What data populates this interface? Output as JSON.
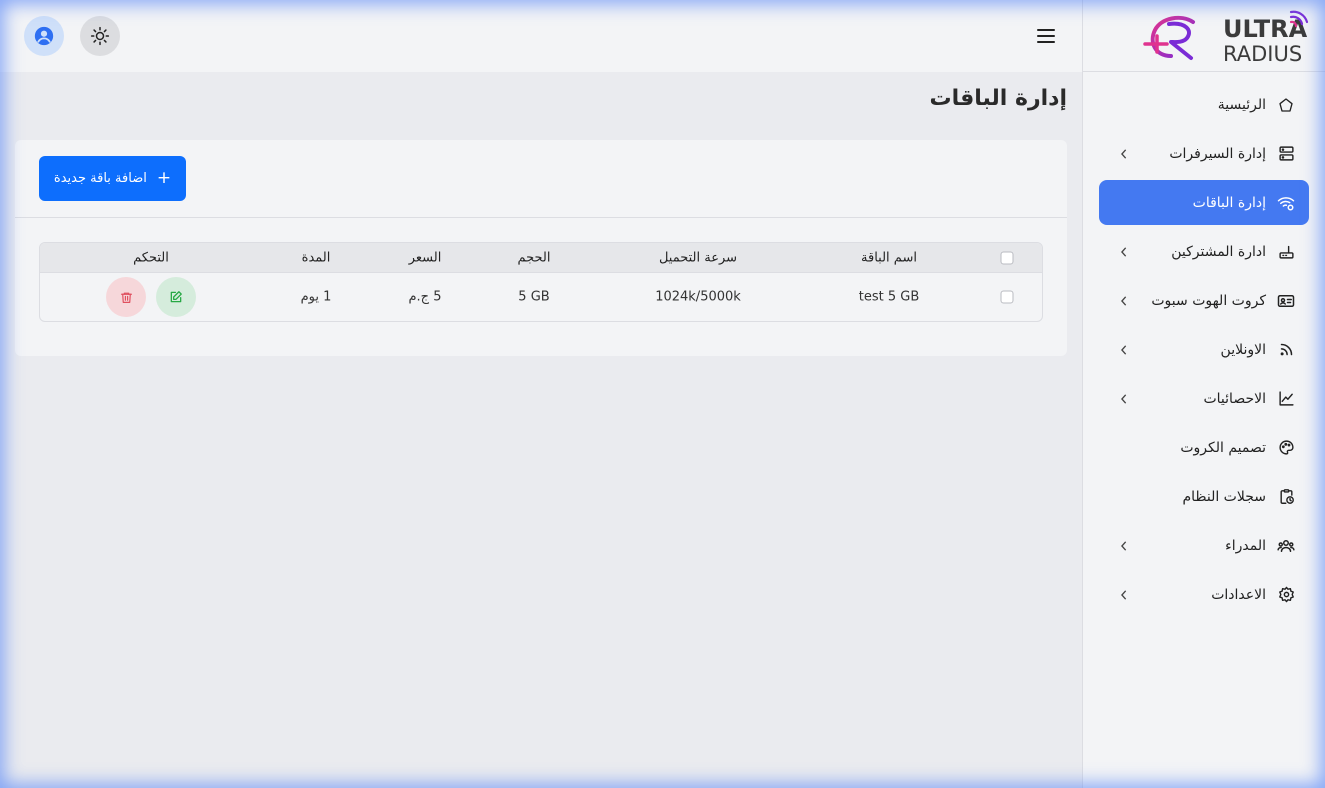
{
  "brand": {
    "line1": "ULTRA",
    "line2": "RADIUS",
    "accent": "#8a2be2",
    "accent2": "#e0338f"
  },
  "colors": {
    "primary": "#0d6efd",
    "active_nav": "#4479f1",
    "edit_bg": "#d5ecdc",
    "edit_icon": "#27a844",
    "delete_bg": "#f6d7da",
    "delete_icon": "#e0505f"
  },
  "sidebar": {
    "items": [
      {
        "label": "الرئيسية",
        "icon": "home-icon",
        "chevron": false
      },
      {
        "label": "إدارة السيرفرات",
        "icon": "server-icon",
        "chevron": true
      },
      {
        "label": "إدارة الباقات",
        "icon": "wifi-settings-icon",
        "chevron": false,
        "active": true
      },
      {
        "label": "ادارة المشتركين",
        "icon": "router-icon",
        "chevron": true
      },
      {
        "label": "كروت الهوت سبوت",
        "icon": "id-card-icon",
        "chevron": true
      },
      {
        "label": "الاونلاين",
        "icon": "rss-icon",
        "chevron": true
      },
      {
        "label": "الاحصائيات",
        "icon": "chart-line-icon",
        "chevron": true
      },
      {
        "label": "تصميم الكروت",
        "icon": "palette-icon",
        "chevron": false
      },
      {
        "label": "سجلات النظام",
        "icon": "clipboard-clock-icon",
        "chevron": false
      },
      {
        "label": "المدراء",
        "icon": "users-icon",
        "chevron": true
      },
      {
        "label": "الاعدادات",
        "icon": "gear-icon",
        "chevron": true
      }
    ]
  },
  "page": {
    "title": "إدارة الباقات",
    "add_button": "اضافة باقة جديدة"
  },
  "table": {
    "headers": {
      "name": "اسم الباقة",
      "speed": "سرعة التحميل",
      "size": "الحجم",
      "price": "السعر",
      "duration": "المدة",
      "actions": "التحكم"
    },
    "rows": [
      {
        "name": "test 5 GB",
        "speed": "1024k/5000k",
        "size": "5 GB",
        "price": "5 ج.م",
        "duration": "1 يوم"
      }
    ]
  }
}
